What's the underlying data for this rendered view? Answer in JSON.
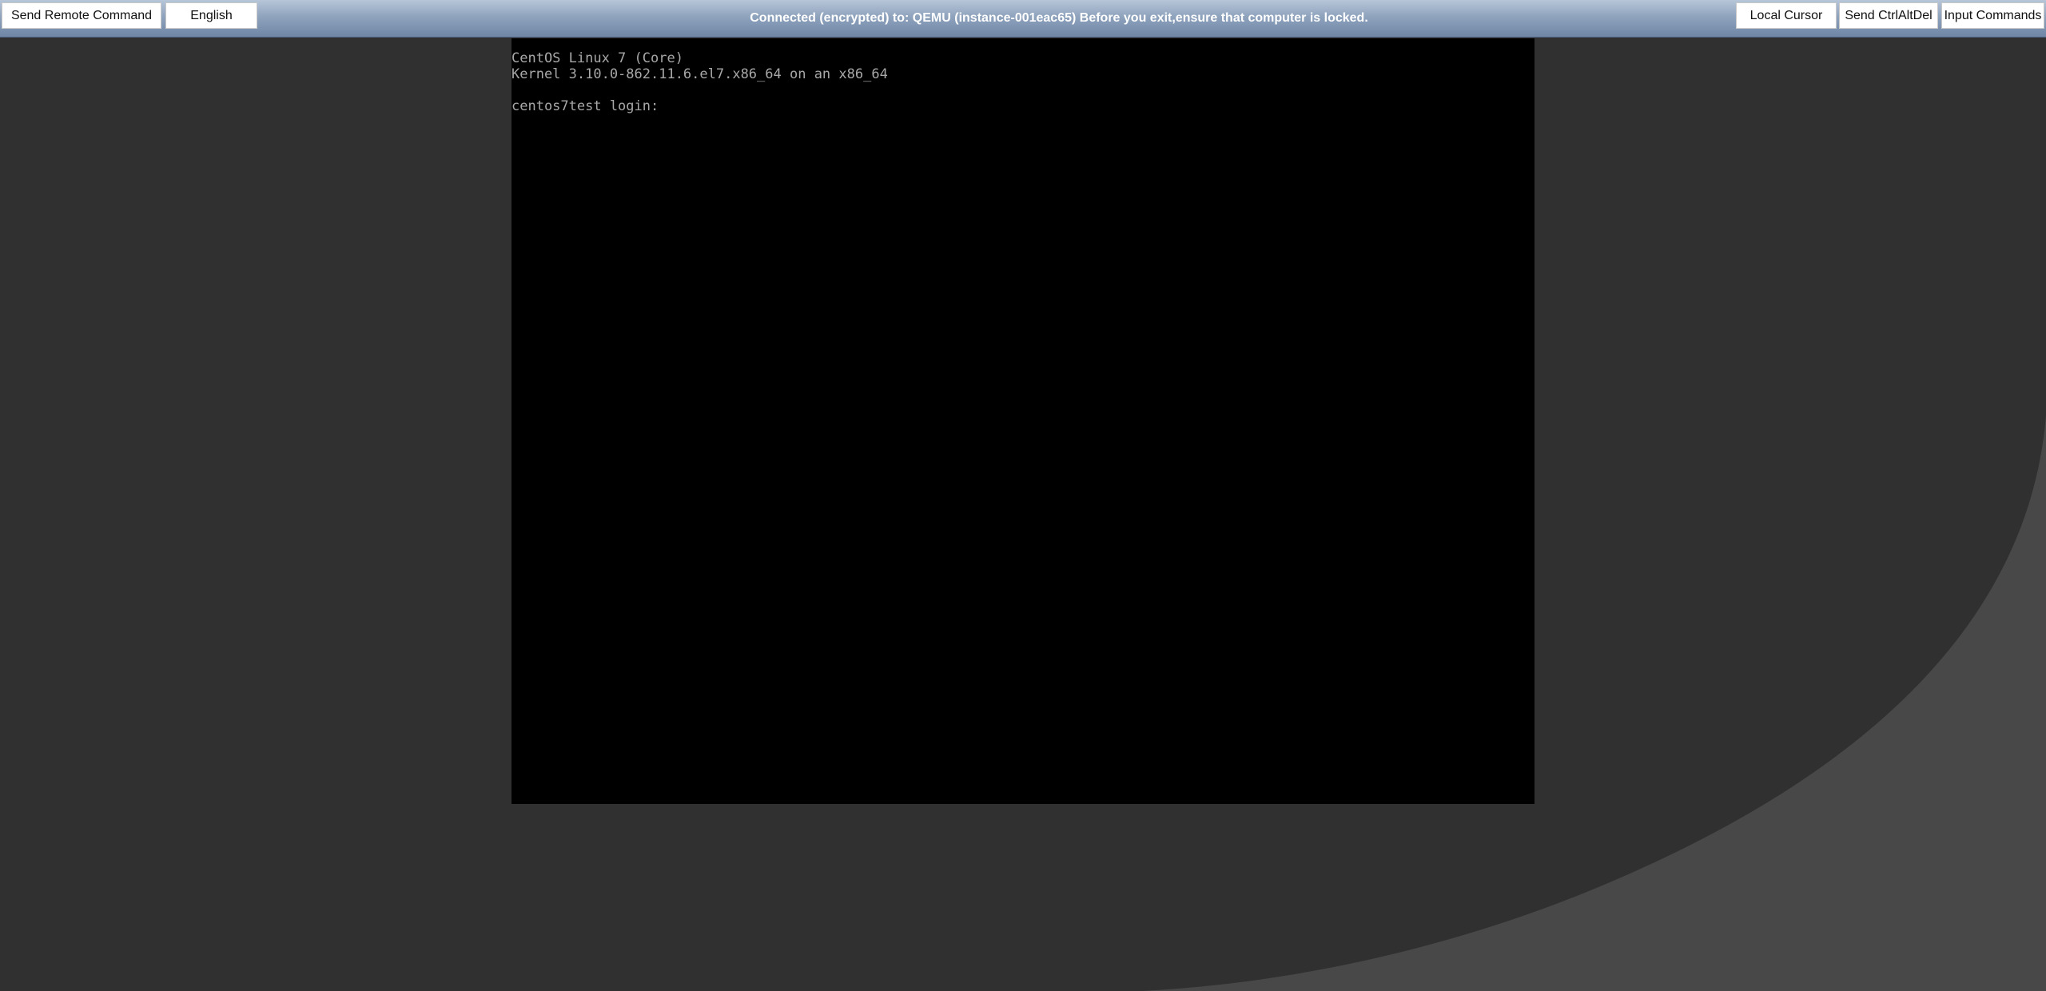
{
  "toolbar": {
    "send_remote_command": "Send Remote Command",
    "language": "English",
    "status": "Connected (encrypted) to: QEMU (instance-001eac65) Before you exit,ensure that computer is locked.",
    "local_cursor": "Local Cursor",
    "send_ctrlaltdel": "Send CtrlAltDel",
    "input_commands": "Input Commands"
  },
  "console": {
    "lines": [
      "CentOS Linux 7 (Core)",
      "Kernel 3.10.0-862.11.6.el7.x86_64 on an x86_64",
      "",
      "centos7test login:"
    ],
    "background": "#000000",
    "text_color": "#a8a8a8"
  },
  "colors": {
    "toolbar_accent": "#8fa3bd",
    "page_background": "#303030",
    "curve_background": "#484848"
  }
}
